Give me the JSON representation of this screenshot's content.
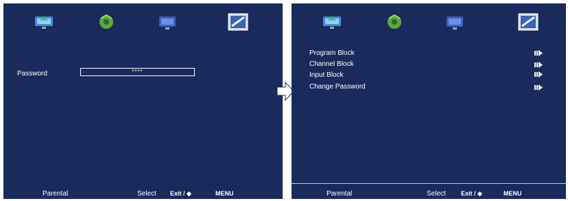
{
  "left_screen": {
    "password_label": "Password",
    "password_value": "****",
    "footer": {
      "title": "Parental",
      "select": "Select",
      "exit": "Exit / ◆",
      "menu": "MENU"
    }
  },
  "right_screen": {
    "menu_items": [
      {
        "label": "Program Block",
        "arrow": "play-arrow-icon"
      },
      {
        "label": "Channel Block",
        "arrow": "play-arrow-icon"
      },
      {
        "label": "Input Block",
        "arrow": "play-arrow-icon"
      },
      {
        "label": "Change Password",
        "arrow": "play-arrow-icon"
      }
    ],
    "footer": {
      "title": "Parental",
      "select": "Select",
      "exit": "Exit / ◆",
      "menu": "MENU"
    }
  },
  "tab_icons": [
    "tv-picture-icon",
    "audio-disc-icon",
    "tv-setup-icon",
    "parental-lock-icon"
  ],
  "colors": {
    "panel_bg": "#1b2a5c",
    "text": "#ffffff"
  }
}
